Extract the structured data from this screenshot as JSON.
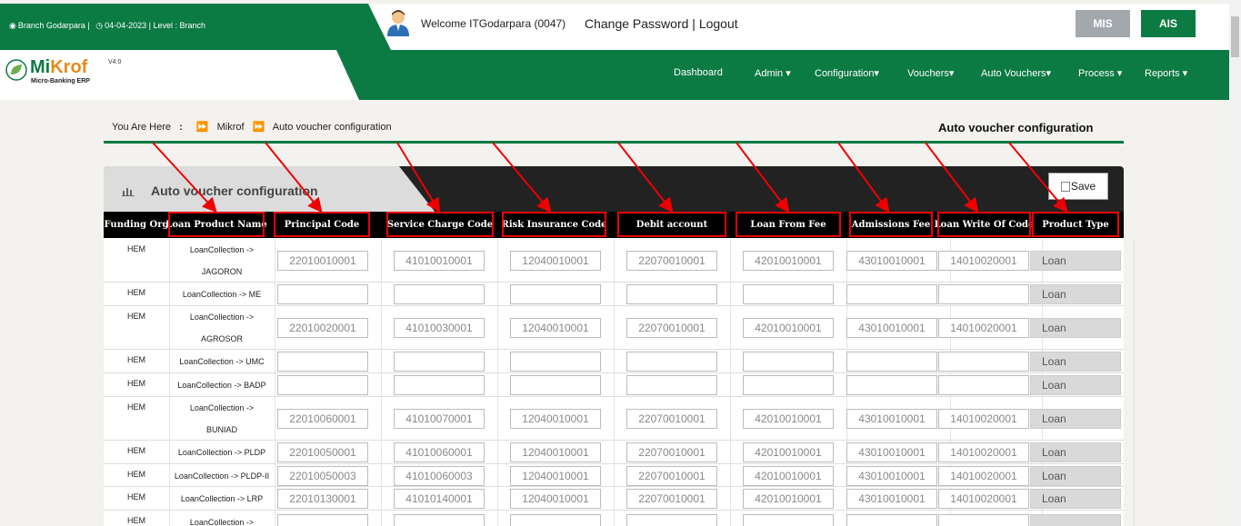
{
  "header": {
    "branch_text": "Branch Godarpara |",
    "date_level": "04-04-2023 | Level : Branch",
    "welcome": "Welcome ITGodarpara (0047)",
    "change_password": "Change Password",
    "separator": "|",
    "logout": "Logout",
    "mis_label": "MIS",
    "ais_label": "AIS"
  },
  "logo": {
    "name_part1": "Mi",
    "name_part2": "Krof",
    "version": "V4.0",
    "subtitle": "Micro-Banking ERP"
  },
  "nav": {
    "items": [
      "Dashboard",
      "Admin ▾",
      "Configuration▾",
      "Vouchers▾",
      "Auto Vouchers▾",
      "Process ▾",
      "Reports ▾"
    ]
  },
  "breadcrumb": {
    "you_are_here": "You Are Here",
    "colon": ":",
    "root": "Mikrof",
    "current": "Auto voucher configuration"
  },
  "page_title": "Auto voucher configuration",
  "panel": {
    "title": "Auto voucher configuration",
    "save_label": "Save"
  },
  "table": {
    "columns": [
      "Funding Org",
      "Loan Product Name",
      "Principal Code",
      "Service Charge Code",
      "Risk Insurance Code",
      "Debit account",
      "Loan From Fee",
      "Admissions Fee",
      "Loan Write Of Code",
      "Product Type"
    ],
    "rows": [
      {
        "org": "HEM",
        "product_line1": "LoanCollection ->",
        "product_line2": "JAGORON",
        "codes": [
          "22010010001",
          "41010010001",
          "12040010001",
          "22070010001",
          "42010010001",
          "43010010001",
          "14010020001"
        ],
        "type": "Loan"
      },
      {
        "org": "HEM",
        "product_line1": "LoanCollection -> ME",
        "product_line2": "",
        "codes": [
          "",
          "",
          "",
          "",
          "",
          "",
          ""
        ],
        "type": "Loan"
      },
      {
        "org": "HEM",
        "product_line1": "LoanCollection ->",
        "product_line2": "AGROSOR",
        "codes": [
          "22010020001",
          "41010030001",
          "12040010001",
          "22070010001",
          "42010010001",
          "43010010001",
          "14010020001"
        ],
        "type": "Loan"
      },
      {
        "org": "HEM",
        "product_line1": "LoanCollection -> UMC",
        "product_line2": "",
        "codes": [
          "",
          "",
          "",
          "",
          "",
          "",
          ""
        ],
        "type": "Loan"
      },
      {
        "org": "HEM",
        "product_line1": "LoanCollection -> BADP",
        "product_line2": "",
        "codes": [
          "",
          "",
          "",
          "",
          "",
          "",
          ""
        ],
        "type": "Loan"
      },
      {
        "org": "HEM",
        "product_line1": "LoanCollection ->",
        "product_line2": "BUNIAD",
        "codes": [
          "22010060001",
          "41010070001",
          "12040010001",
          "22070010001",
          "42010010001",
          "43010010001",
          "14010020001"
        ],
        "type": "Loan"
      },
      {
        "org": "HEM",
        "product_line1": "LoanCollection -> PLDP",
        "product_line2": "",
        "codes": [
          "22010050001",
          "41010060001",
          "12040010001",
          "22070010001",
          "42010010001",
          "43010010001",
          "14010020001"
        ],
        "type": "Loan"
      },
      {
        "org": "HEM",
        "product_line1": "LoanCollection -> PLDP-II",
        "product_line2": "",
        "codes": [
          "22010050003",
          "41010060003",
          "12040010001",
          "22070010001",
          "42010010001",
          "43010010001",
          "14010020001"
        ],
        "type": "Loan"
      },
      {
        "org": "HEM",
        "product_line1": "LoanCollection -> LRP",
        "product_line2": "",
        "codes": [
          "22010130001",
          "41010140001",
          "12040010001",
          "22070010001",
          "42010010001",
          "43010010001",
          "14010020001"
        ],
        "type": "Loan"
      },
      {
        "org": "HEM",
        "product_line1": "LoanCollection ->",
        "product_line2": "",
        "codes": [
          "",
          "",
          "",
          "",
          "",
          "",
          ""
        ],
        "type": ""
      }
    ]
  },
  "colors": {
    "brand_green": "#0b7a43",
    "annotation_red": "#e00000",
    "mis_gray": "#a3a8ad"
  }
}
